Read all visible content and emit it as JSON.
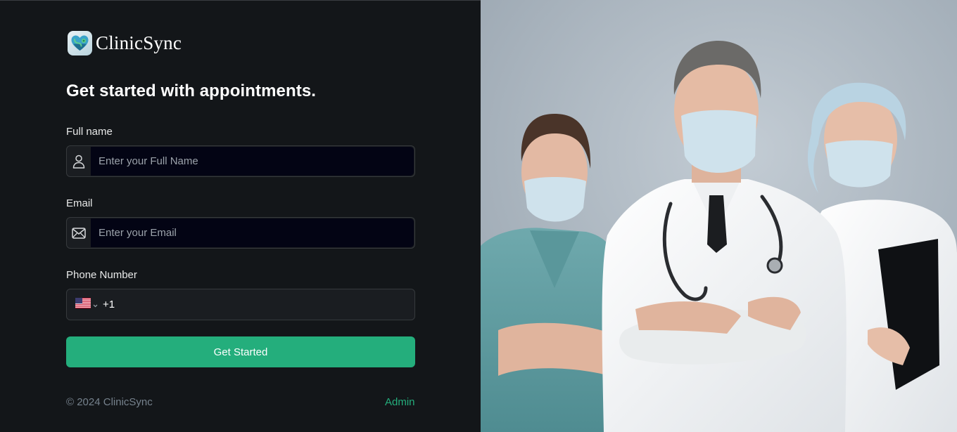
{
  "brand": {
    "name": "ClinicSync",
    "logo_icon": "heart-stethoscope-icon"
  },
  "heading": "Get started with appointments.",
  "form": {
    "full_name": {
      "label": "Full name",
      "placeholder": "Enter your Full Name",
      "value": "",
      "icon": "user-icon"
    },
    "email": {
      "label": "Email",
      "placeholder": "Enter your Email",
      "value": "",
      "icon": "envelope-icon"
    },
    "phone": {
      "label": "Phone Number",
      "country": "US",
      "dial_code": "+1",
      "value": ""
    },
    "submit_label": "Get Started"
  },
  "footer": {
    "copyright": "© 2024 ClinicSync",
    "admin_label": "Admin"
  },
  "hero": {
    "image_subject": "three-masked-doctors-photo"
  },
  "colors": {
    "background": "#131619",
    "accent": "#24ae7c",
    "input_bg": "#030414",
    "muted_text": "#76828d"
  }
}
